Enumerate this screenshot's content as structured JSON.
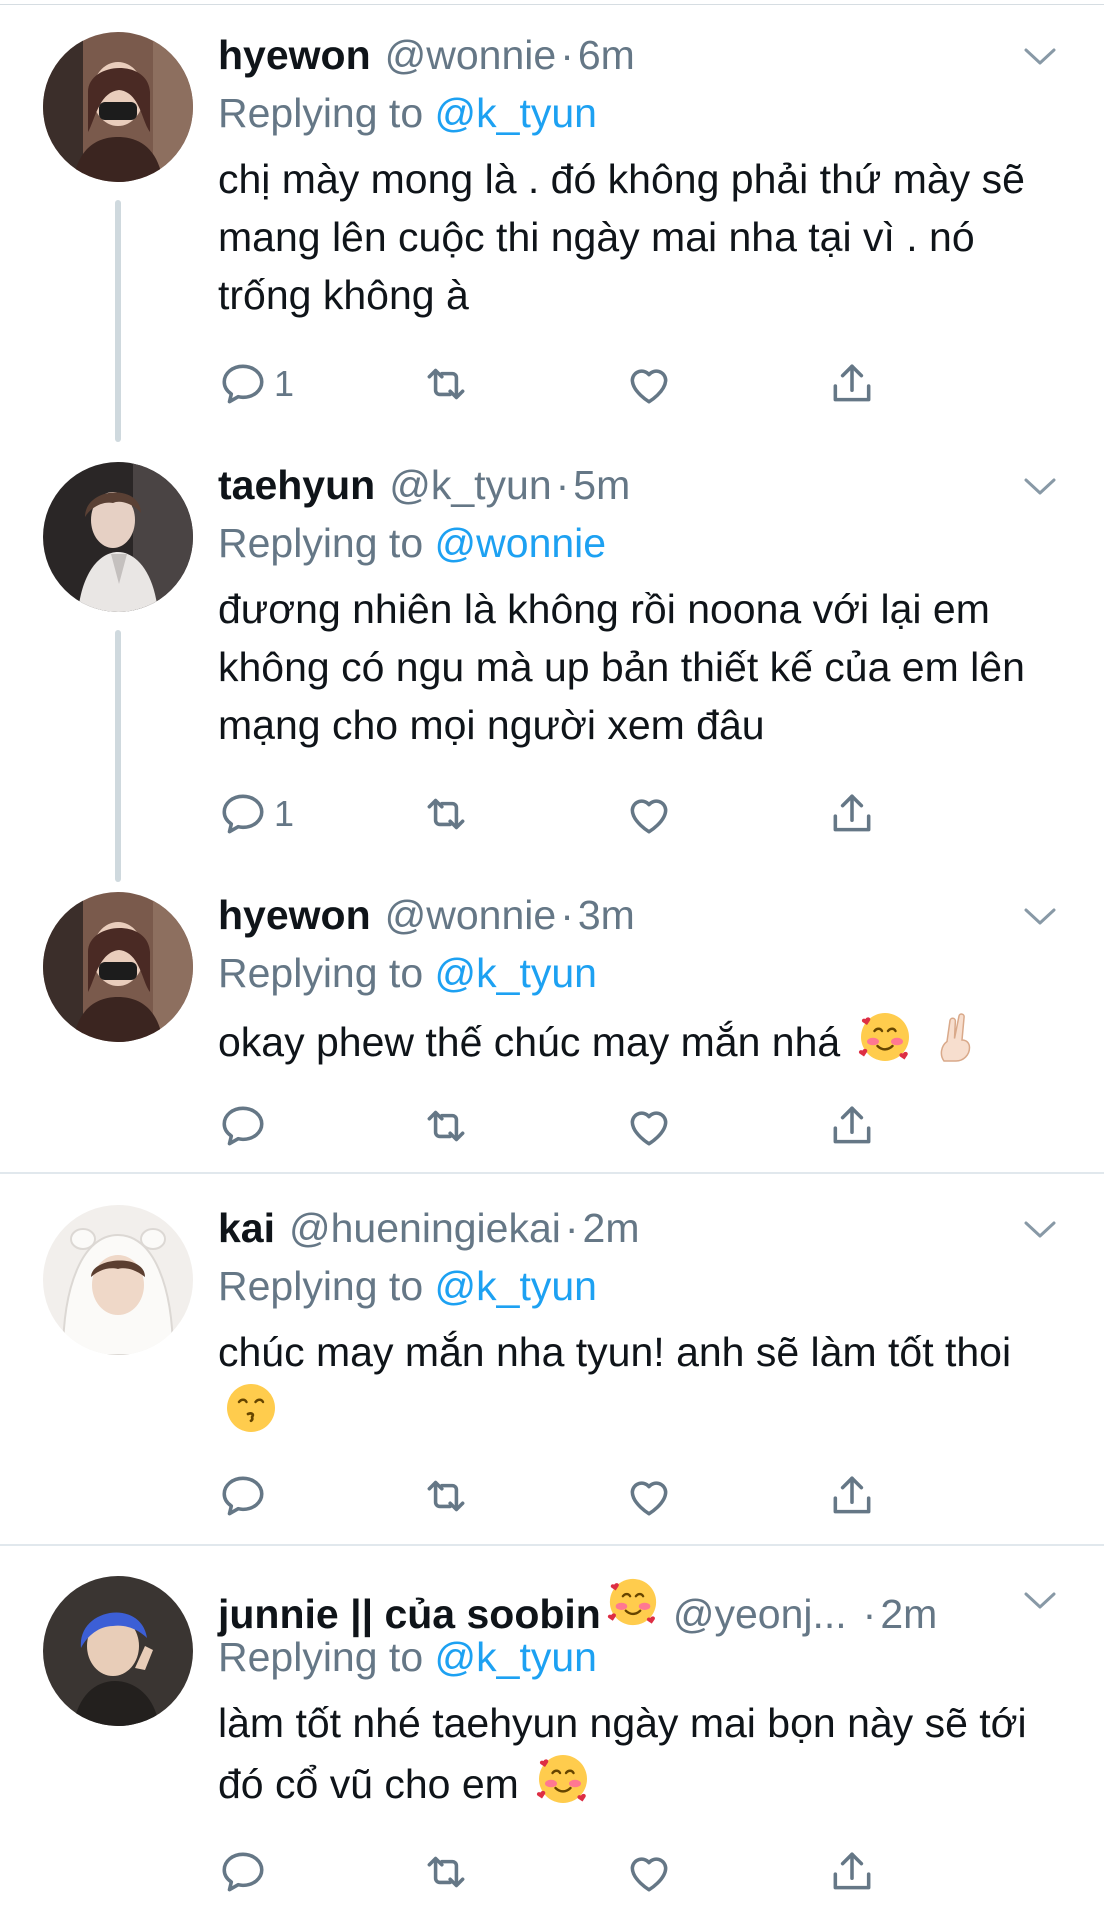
{
  "tweets": [
    {
      "name": "hyewon",
      "handle": "@wonnie",
      "time": "6m",
      "replying_prefix": "Replying to",
      "replying_to": "@k_tyun",
      "text": "chị mày mong là . đó không phải thứ mày sẽ mang lên cuộc thi ngày mai nha tại vì . nó trống không à",
      "reply_count": "1",
      "avatar_icon": "avatar-photo"
    },
    {
      "name": "taehyun",
      "handle": "@k_tyun",
      "time": "5m",
      "replying_prefix": "Replying to",
      "replying_to": "@wonnie",
      "text": "đương nhiên là không rồi noona với lại em không có ngu mà up bản thiết kế của em lên mạng cho mọi người xem đâu",
      "reply_count": "1",
      "avatar_icon": "avatar-photo"
    },
    {
      "name": "hyewon",
      "handle": "@wonnie",
      "time": "3m",
      "replying_prefix": "Replying to",
      "replying_to": "@k_tyun",
      "text": "okay phew thế chúc may mắn nhá",
      "emojis": [
        "smiling-face-with-hearts-emoji",
        "crossed-fingers-emoji"
      ],
      "reply_count": "",
      "avatar_icon": "avatar-photo"
    },
    {
      "name": "kai",
      "handle": "@hueningiekai",
      "time": "2m",
      "replying_prefix": "Replying to",
      "replying_to": "@k_tyun",
      "text": "chúc may mắn nha tyun! anh sẽ làm tốt thoi",
      "emojis": [
        "kissing-face-emoji"
      ],
      "reply_count": "",
      "avatar_icon": "avatar-photo"
    },
    {
      "name": "junnie || của soobin",
      "name_emoji": "smiling-face-with-hearts-emoji",
      "handle": "@yeonj...",
      "time": "2m",
      "replying_prefix": "Replying to",
      "replying_to": "@k_tyun",
      "text": "làm tốt nhé taehyun ngày mai bọn này sẽ tới đó cổ vũ cho em",
      "emojis": [
        "smiling-face-with-hearts-emoji"
      ],
      "reply_count": "",
      "avatar_icon": "avatar-photo"
    }
  ],
  "dot_separator": "·",
  "colors": {
    "link": "#1da1f2",
    "secondary": "#657786",
    "text": "#0f1419",
    "thread_line": "#cfd9de",
    "divider": "#e1e8ed"
  },
  "action_icons": [
    "reply-icon",
    "retweet-icon",
    "like-icon",
    "share-icon"
  ]
}
